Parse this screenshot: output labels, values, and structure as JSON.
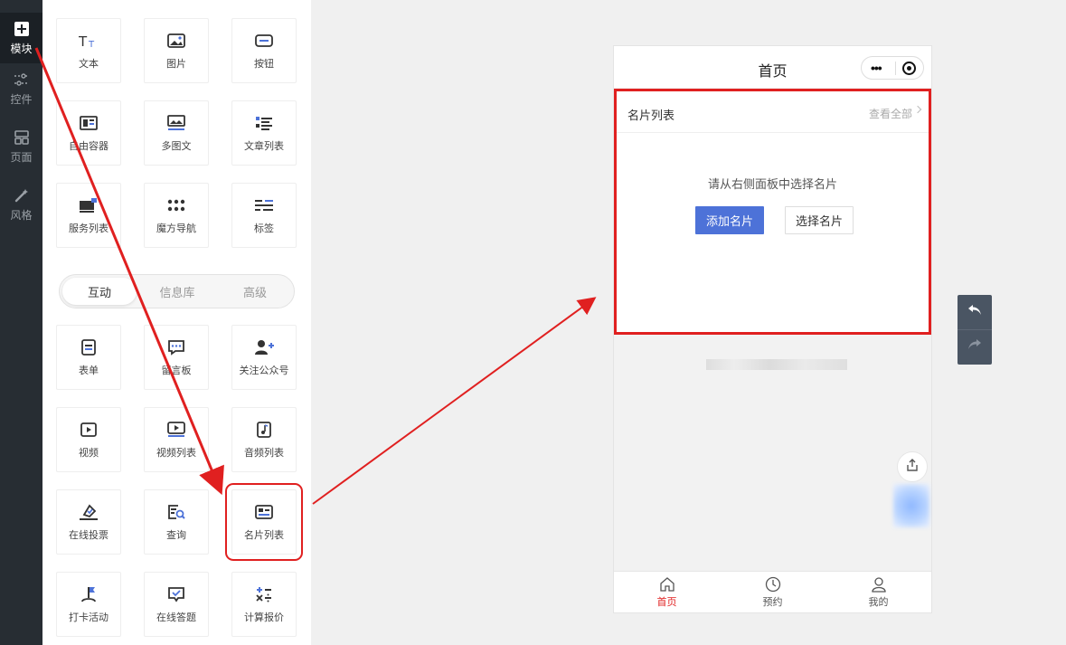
{
  "rail": {
    "items": [
      {
        "label": "模块",
        "icon": "plus-square-icon"
      },
      {
        "label": "控件",
        "icon": "sliders-icon"
      },
      {
        "label": "页面",
        "icon": "pages-icon"
      },
      {
        "label": "风格",
        "icon": "magic-wand-icon"
      }
    ]
  },
  "modules": {
    "basic": [
      {
        "label": "文本",
        "icon": "text-icon"
      },
      {
        "label": "图片",
        "icon": "image-icon"
      },
      {
        "label": "按钮",
        "icon": "button-icon"
      },
      {
        "label": "自由容器",
        "icon": "container-icon"
      },
      {
        "label": "多图文",
        "icon": "multi-image-text-icon"
      },
      {
        "label": "文章列表",
        "icon": "article-list-icon"
      },
      {
        "label": "服务列表",
        "icon": "service-list-icon"
      },
      {
        "label": "魔方导航",
        "icon": "cube-nav-icon"
      },
      {
        "label": "标签",
        "icon": "tag-icon"
      }
    ],
    "tabs": [
      {
        "label": "互动",
        "active": true
      },
      {
        "label": "信息库",
        "active": false
      },
      {
        "label": "高级",
        "active": false
      }
    ],
    "interactive": [
      {
        "label": "表单",
        "icon": "form-icon"
      },
      {
        "label": "留言板",
        "icon": "message-board-icon"
      },
      {
        "label": "关注公众号",
        "icon": "follow-account-icon"
      },
      {
        "label": "视频",
        "icon": "video-icon"
      },
      {
        "label": "视频列表",
        "icon": "video-list-icon"
      },
      {
        "label": "音频列表",
        "icon": "audio-list-icon"
      },
      {
        "label": "在线投票",
        "icon": "vote-icon"
      },
      {
        "label": "查询",
        "icon": "query-icon"
      },
      {
        "label": "名片列表",
        "icon": "business-card-icon"
      },
      {
        "label": "打卡活动",
        "icon": "check-in-flag-icon"
      },
      {
        "label": "在线答题",
        "icon": "quiz-icon"
      },
      {
        "label": "计算报价",
        "icon": "calculator-icon"
      }
    ]
  },
  "phone": {
    "title": "首页",
    "card": {
      "title": "名片列表",
      "more": "查看全部",
      "hint": "请从右侧面板中选择名片",
      "add_label": "添加名片",
      "pick_label": "选择名片"
    },
    "tabbar": [
      {
        "label": "首页",
        "icon": "home-icon",
        "active": true
      },
      {
        "label": "预约",
        "icon": "clock-icon",
        "active": false
      },
      {
        "label": "我的",
        "icon": "user-icon",
        "active": false
      }
    ]
  },
  "colors": {
    "accent_blue": "#4d72d8",
    "annotation_red": "#e02020",
    "rail_bg": "#272d33",
    "history_bg": "#4a5563"
  }
}
